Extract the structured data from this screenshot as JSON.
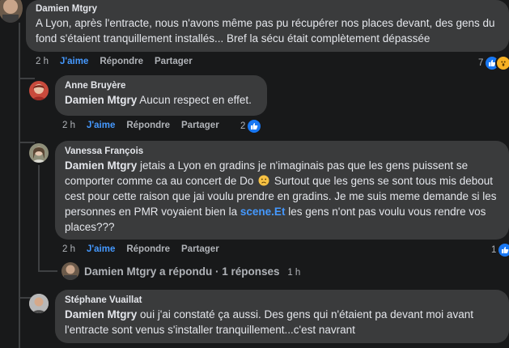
{
  "comments": [
    {
      "author": "Damien Mtgry",
      "text_lines": [
        "A Lyon, après l'entracte, nous n'avons même pas pu récupérer nos places devant, des gens du",
        "fond s'étaient tranquillement installés... Bref la sécu était complètement dépassée"
      ],
      "time": "2 h",
      "like": "J'aime",
      "reply": "Répondre",
      "share": "Partager",
      "reaction_count": "7"
    },
    {
      "author": "Anne Bruyère",
      "mention": "Damien Mtgry",
      "text": "Aucun respect en effet.",
      "time": "2 h",
      "like": "J'aime",
      "reply": "Répondre",
      "share": "Partager",
      "reaction_count": "2"
    },
    {
      "author": "Vanessa François",
      "mention": "Damien Mtgry",
      "text_line1": "jetais a Lyon en gradins je n'imaginais pas que les gens puissent se",
      "text_line2a": "comporter comme ca au concert de Do",
      "text_line2b": "Surtout que les gens se sont tous mis debout",
      "text_line3": "cest pour cette raison que jai voulu prendre en gradins. Je me suis meme demande si les",
      "text_line4a": "personnes en PMR voyaient bien la",
      "link": "scene.Et",
      "text_line4b": "les gens n'ont pas voulu vous rendre vos",
      "text_line5": "places???",
      "time": "2 h",
      "like": "J'aime",
      "reply": "Répondre",
      "share": "Partager",
      "reaction_count": "1"
    },
    {
      "author": "Stéphane Vuaillat",
      "mention": "Damien Mtgry",
      "text_line1": "oui j'ai constaté ça aussi. Des gens qui n'étaient pa devant moi avant",
      "text_line2": "l'entracte sont venus s'installer tranquillement...c'est navrant"
    }
  ],
  "reply_summary": {
    "text": "Damien Mtgry a répondu · 1 réponses",
    "time": "1 h"
  },
  "colors": {
    "background": "#18191a",
    "bubble": "#3a3b3c",
    "like_blue": "#4599ff",
    "muted": "#b0b3b8"
  },
  "icons": [
    "thumbs-up-icon",
    "wow-emoji-icon",
    "slightly-frowning-emoji-icon"
  ]
}
